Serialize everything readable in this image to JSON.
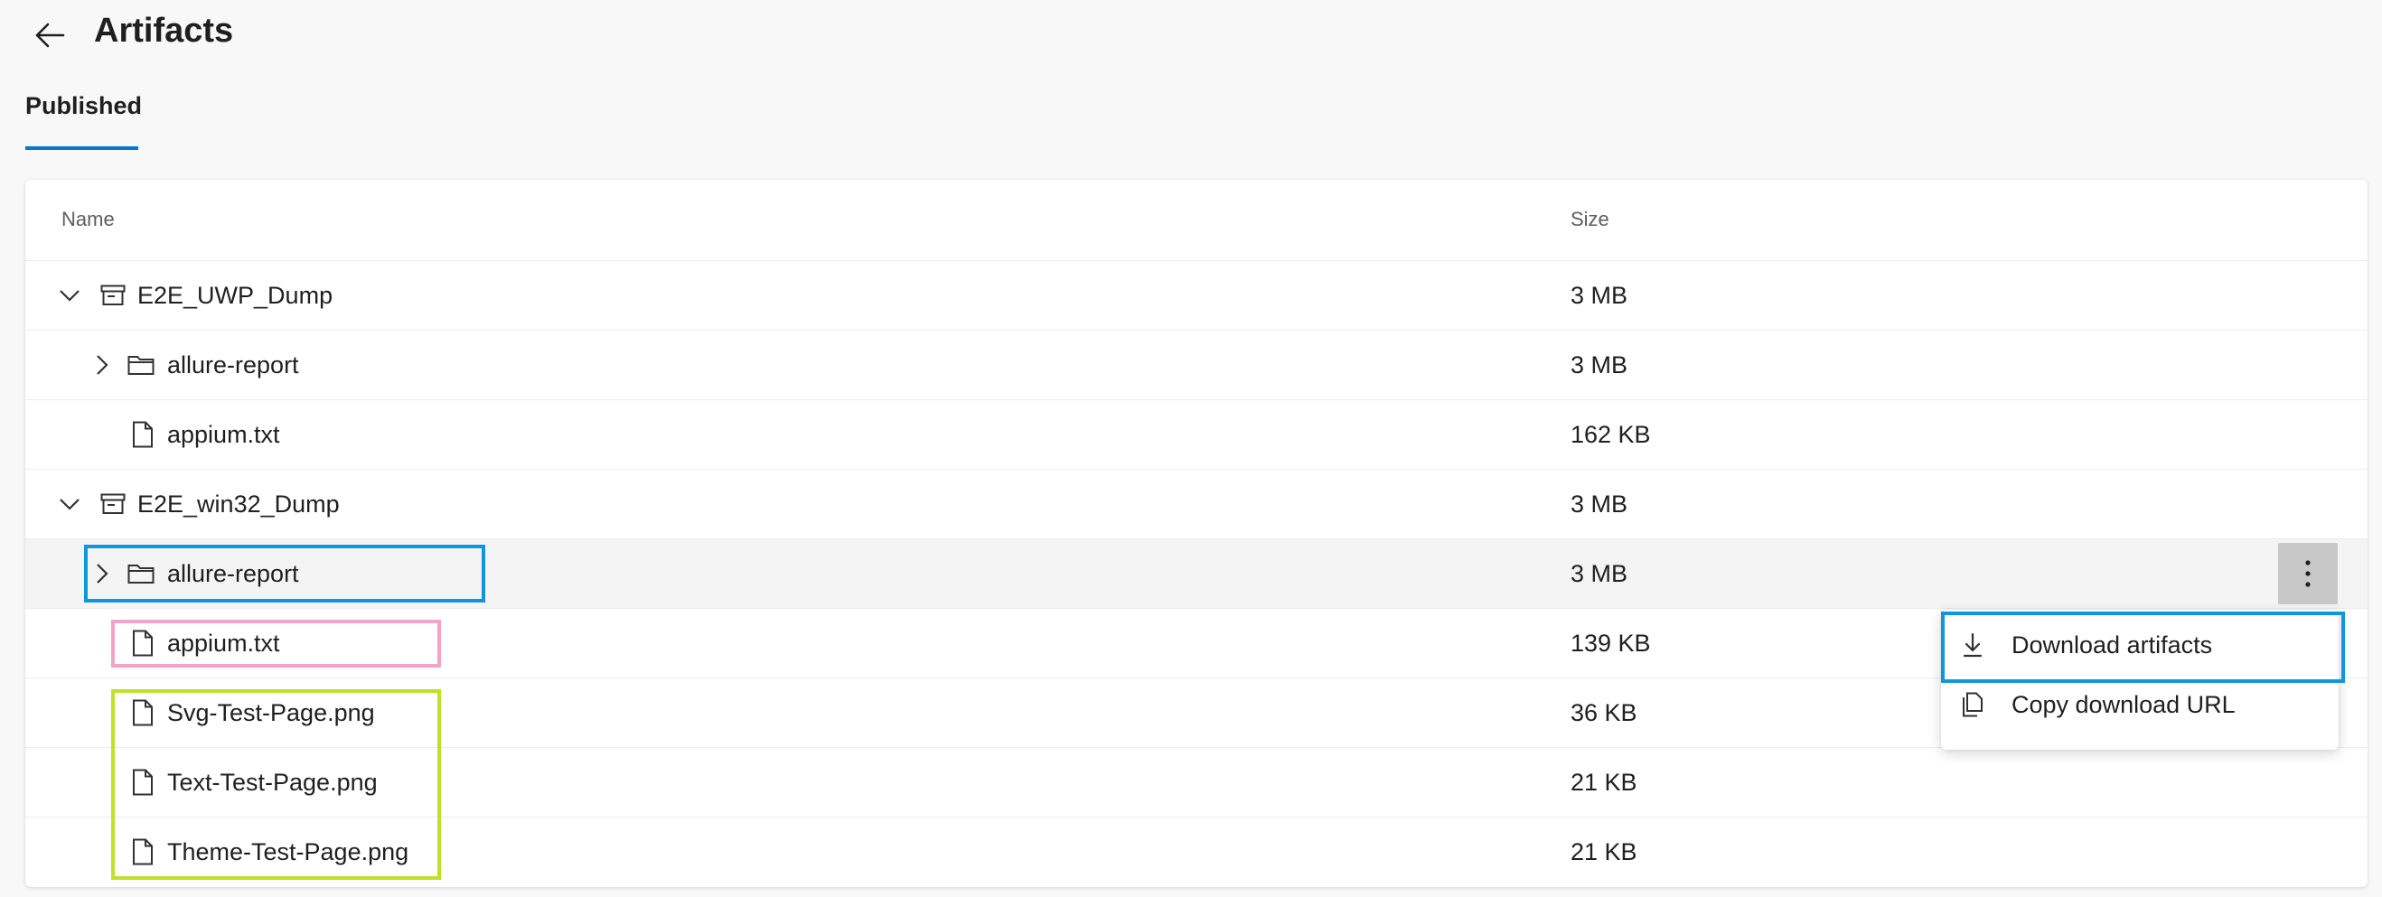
{
  "header": {
    "title": "Artifacts"
  },
  "tabs": [
    {
      "label": "Published"
    }
  ],
  "table": {
    "columns": {
      "name": "Name",
      "size": "Size"
    },
    "rows": [
      {
        "name": "E2E_UWP_Dump",
        "size": "3 MB",
        "icon": "artifact-icon",
        "expand": "expanded",
        "level": 0
      },
      {
        "name": "allure-report",
        "size": "3 MB",
        "icon": "folder-icon",
        "expand": "collapsed",
        "level": 1
      },
      {
        "name": "appium.txt",
        "size": "162 KB",
        "icon": "file-icon",
        "expand": "none",
        "level": 1
      },
      {
        "name": "E2E_win32_Dump",
        "size": "3 MB",
        "icon": "artifact-icon",
        "expand": "expanded",
        "level": 0
      },
      {
        "name": "allure-report",
        "size": "3 MB",
        "icon": "folder-icon",
        "expand": "collapsed",
        "level": 1
      },
      {
        "name": "appium.txt",
        "size": "139 KB",
        "icon": "file-icon",
        "expand": "none",
        "level": 1
      },
      {
        "name": "Svg-Test-Page.png",
        "size": "36 KB",
        "icon": "file-icon",
        "expand": "none",
        "level": 1
      },
      {
        "name": "Text-Test-Page.png",
        "size": "21 KB",
        "icon": "file-icon",
        "expand": "none",
        "level": 1
      },
      {
        "name": "Theme-Test-Page.png",
        "size": "21 KB",
        "icon": "file-icon",
        "expand": "none",
        "level": 1
      }
    ]
  },
  "context_menu": {
    "items": [
      {
        "label": "Download artifacts",
        "icon": "download-icon"
      },
      {
        "label": "Copy download URL",
        "icon": "copy-icon"
      }
    ]
  },
  "colors": {
    "accent": "#0078d4",
    "highlight_blue": "#1296db",
    "highlight_pink": "#f4a3c8",
    "highlight_green": "#bfe12a"
  }
}
